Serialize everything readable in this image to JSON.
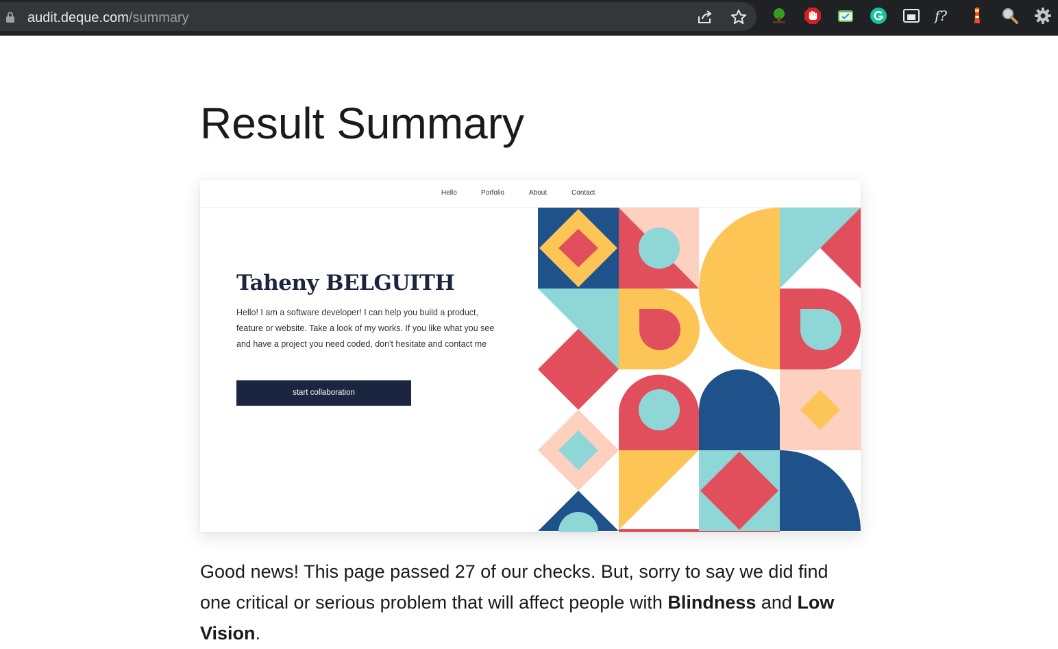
{
  "browser": {
    "url_host": "audit.deque.com",
    "url_path": "/summary",
    "omnibox_buttons": [
      "share-icon",
      "bookmark-star-icon"
    ],
    "extensions": [
      "tree-extension-icon",
      "stop-hand-extension-icon",
      "mail-check-extension-icon",
      "grammarly-icon",
      "picture-in-picture-icon",
      "font-finder-icon",
      "lighthouse-icon",
      "magnifier-icon",
      "gear-icon"
    ],
    "font_finder_label": "f?"
  },
  "page": {
    "title": "Result Summary"
  },
  "screenshot": {
    "nav": [
      "Hello",
      "Porfolio",
      "About",
      "Contact"
    ],
    "name": "Taheny BELGUITH",
    "bio": "Hello! I am a software developer! I can help you build a product, feature or website. Take a look of my works. If you like what you see and have a project you need coded, don't hesitate and contact me",
    "button": "start collaboration",
    "art_colors": {
      "navy": "#1f528a",
      "yellow": "#fdc456",
      "red": "#e14e5c",
      "teal": "#8fd6d6",
      "peach": "#fdd0c0"
    }
  },
  "summary": {
    "part1": "Good news! This page passed 27 of our checks. But, sorry to say we did find one critical or serious problem that will affect people with ",
    "impact1": "Blindness",
    "and": " and ",
    "impact2": "Low Vision",
    "end": "."
  }
}
